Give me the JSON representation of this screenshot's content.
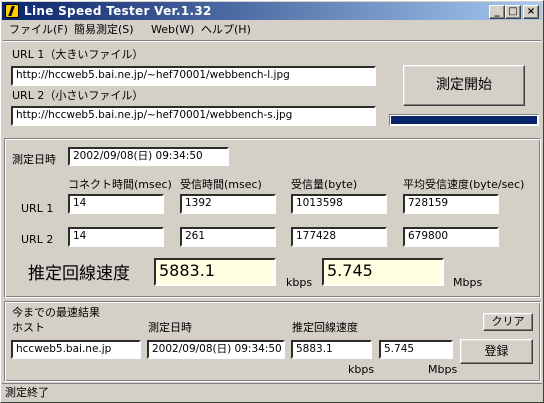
{
  "window": {
    "title": "Line Speed Tester Ver.1.32",
    "icon": "lightning-icon",
    "controls": {
      "minimize": "_",
      "maximize": "□",
      "close": "×"
    }
  },
  "menu": [
    "ファイル(F)",
    "簡易測定(S)",
    "Web(W)",
    "ヘルプ(H)"
  ],
  "urls": {
    "url1_label": "URL 1（大きいファイル）",
    "url1_value": "http://hccweb5.bai.ne.jp/~hef70001/webbench-l.jpg",
    "url2_label": "URL 2（小さいファイル）",
    "url2_value": "http://hccweb5.bai.ne.jp/~hef70001/webbench-s.jpg"
  },
  "start_button": "測定開始",
  "progress": {
    "fraction": 1.0,
    "color": "#0a246a"
  },
  "measure": {
    "datetime_label": "測定日時",
    "datetime_value": "2002/09/08(日) 09:34:50",
    "headers": [
      "コネクト時間(msec)",
      "受信時間(msec)",
      "受信量(byte)",
      "平均受信速度(byte/sec)"
    ],
    "rows": [
      {
        "label": "URL 1",
        "values": [
          "14",
          "1392",
          "1013598",
          "728159"
        ]
      },
      {
        "label": "URL 2",
        "values": [
          "14",
          "261",
          "177428",
          "679800"
        ]
      }
    ],
    "speed_label": "推定回線速度",
    "kbps_value": "5883.1",
    "kbps_unit": "kbps",
    "mbps_value": "5.745",
    "mbps_unit": "Mbps"
  },
  "best": {
    "title": "今までの最速結果",
    "host_label": "ホスト",
    "datetime_label": "測定日時",
    "speed_label": "推定回線速度",
    "host_value": "hccweb5.bai.ne.jp",
    "datetime_value": "2002/09/08(日) 09:34:50",
    "kbps_value": "5883.1",
    "mbps_value": "5.745",
    "kbps_unit": "kbps",
    "mbps_unit": "Mbps",
    "clear_button": "クリア",
    "register_button": "登録"
  },
  "status_text": "測定終了"
}
